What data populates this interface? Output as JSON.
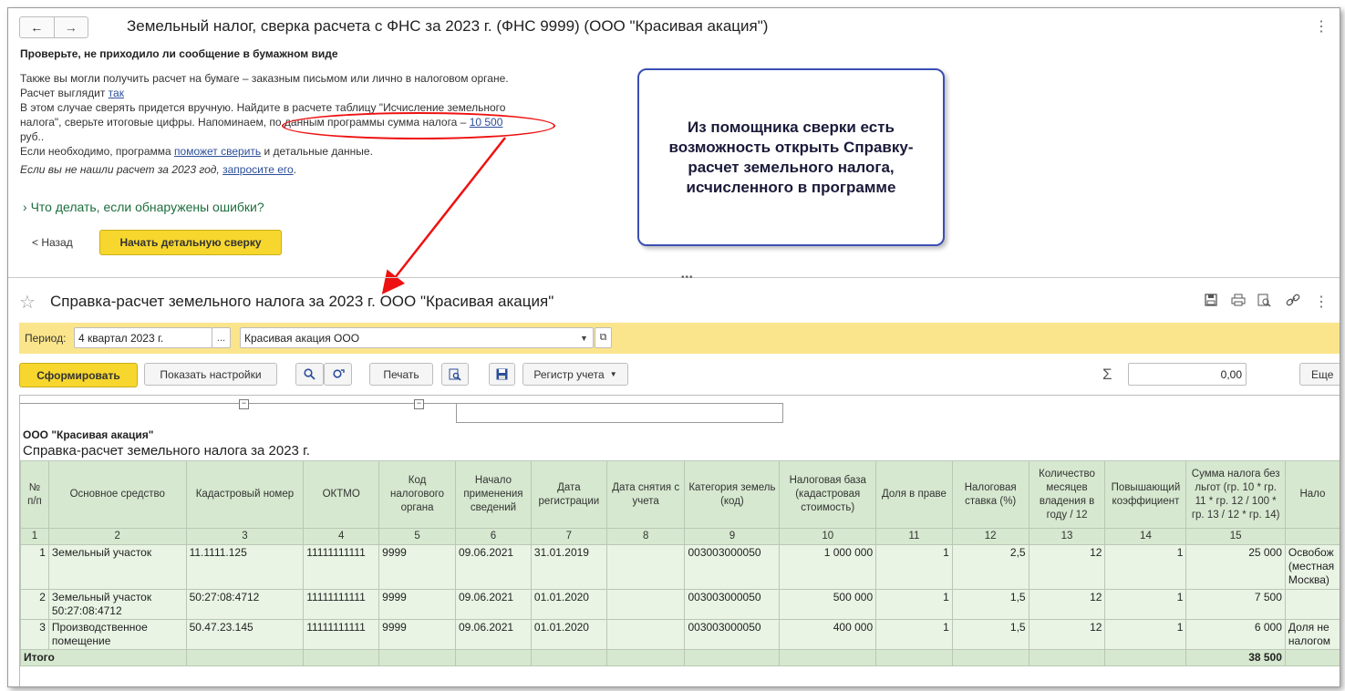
{
  "window": {
    "back_icon": "←",
    "forward_icon": "→",
    "title": "Земельный налог, сверка расчета с ФНС за 2023 г. (ФНС 9999) (ООО \"Красивая акация\")",
    "menu_icon": "⋮"
  },
  "check": {
    "heading": "Проверьте, не приходило ли сообщение в бумажном виде",
    "line1": "Также вы могли получить расчет на бумаге – заказным письмом или лично в налоговом органе.",
    "line2_prefix": "Расчет выглядит",
    "line2_link": "так",
    "line3": "В этом случае сверять придется вручную. Найдите в расчете таблицу \"Исчисление земельного",
    "line4_prefix": "налога\", сверьте итоговые цифры. Напоминаем, по данным программы сумма налога –",
    "line4_link": "10 500",
    "line5": "руб..",
    "line6_prefix": "Если необходимо, программа",
    "line6_link": "поможет сверить",
    "line6_suffix": "и детальные данные.",
    "line7_prefix": "Если вы не нашли расчет за 2023 год,",
    "line7_link": "запросите его",
    "expander": "Что делать, если обнаружены ошибки?",
    "back_button": "< Назад",
    "start_button": "Начать детальную сверку"
  },
  "callout": {
    "text": "Из помощника сверки есть возможность открыть Справку-расчет земельного налога, исчисленного в программе"
  },
  "report": {
    "splitter_handle": "•••",
    "title": "Справка-расчет земельного налога за 2023 г. ООО \"Красивая акация\"",
    "period_label": "Период:",
    "period_value": "4 квартал 2023 г.",
    "period_picker": "...",
    "org_value": "Красивая акация ООО",
    "generate_button": "Сформировать",
    "settings_button": "Показать настройки",
    "print_button": "Печать",
    "register_button": "Регистр учета",
    "sum_value": "0,00",
    "more_button": "Еще",
    "org_name": "ООО \"Красивая акация\"",
    "sheet_title": "Справка-расчет земельного налога за 2023 г.",
    "columns": [
      "№ п/п",
      "Основное средство",
      "Кадастровый номер",
      "ОКТМО",
      "Код налогового органа",
      "Начало применения сведений",
      "Дата регистрации",
      "Дата снятия с учета",
      "Категория земель (код)",
      "Налоговая база (кадастровая стоимость)",
      "Доля в праве",
      "Налоговая ставка (%)",
      "Количество месяцев владения в году / 12",
      "Повышающий коэффициент",
      "Сумма налога без льгот (гр. 10 * гр. 11 * гр. 12 / 100 * гр. 13 / 12 * гр. 14)",
      "Нало"
    ],
    "column_numbers": [
      "1",
      "2",
      "3",
      "4",
      "5",
      "6",
      "7",
      "8",
      "9",
      "10",
      "11",
      "12",
      "13",
      "14",
      "15",
      ""
    ],
    "rows": [
      [
        "1",
        "Земельный участок",
        "11.1111.125",
        "11111111111",
        "9999",
        "09.06.2021",
        "31.01.2019",
        "",
        "003003000050",
        "1 000 000",
        "1",
        "2,5",
        "12",
        "1",
        "25 000",
        "Освобож (местная Москва)"
      ],
      [
        "2",
        "Земельный участок 50:27:08:4712",
        "50:27:08:4712",
        "11111111111",
        "9999",
        "09.06.2021",
        "01.01.2020",
        "",
        "003003000050",
        "500 000",
        "1",
        "1,5",
        "12",
        "1",
        "7 500",
        ""
      ],
      [
        "3",
        "Производственное помещение",
        "50.47.23.145",
        "11111111111",
        "9999",
        "09.06.2021",
        "01.01.2020",
        "",
        "003003000050",
        "400 000",
        "1",
        "1,5",
        "12",
        "1",
        "6 000",
        "Доля не налогом"
      ]
    ],
    "total_label": "Итого",
    "total_value": "38 500"
  }
}
